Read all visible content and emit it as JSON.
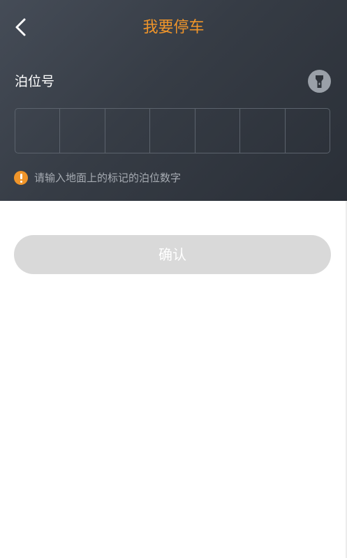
{
  "header": {
    "title": "我要停车",
    "back_icon": "chevron-left-icon",
    "title_color": "#f0952a",
    "background": "#363c45"
  },
  "form": {
    "label": "泊位号",
    "flashlight_icon": "flashlight-icon",
    "code_cells": [
      "",
      "",
      "",
      "",
      "",
      "",
      ""
    ],
    "hint_icon": "exclamation-circle-icon",
    "hint_text": "请输入地面上的标记的泊位数字"
  },
  "actions": {
    "confirm_label": "确认",
    "confirm_bg": "#d9d9d9"
  }
}
